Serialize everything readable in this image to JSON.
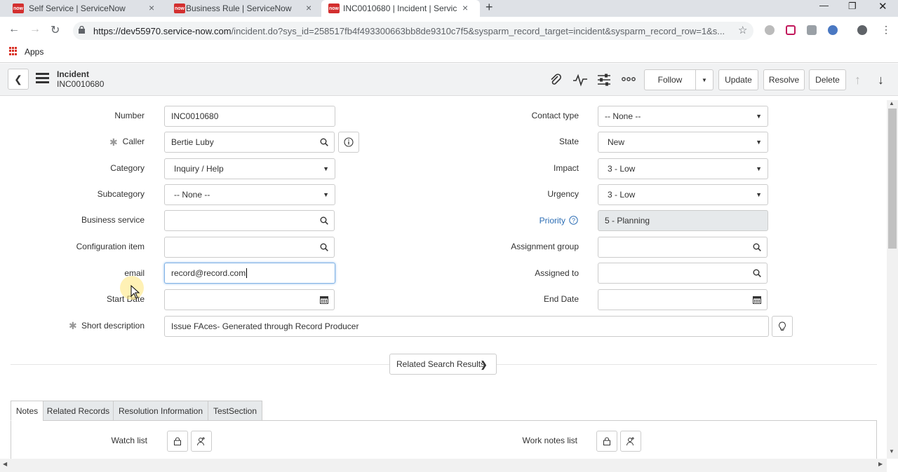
{
  "browser": {
    "tabs": [
      {
        "title": "Self Service | ServiceNow",
        "favicon": "now"
      },
      {
        "title": "Business Rule | ServiceNow",
        "favicon": "now"
      },
      {
        "title": "INC0010680 | Incident | ServiceN",
        "favicon": "now"
      }
    ],
    "url_main": "https://dev55970.service-now.com",
    "url_rest": "/incident.do?sys_id=258517fb4f493300663bb8de9310c7f5&sysparm_record_target=incident&sysparm_record_row=1&s...",
    "bookmarks_apps_label": "Apps"
  },
  "header": {
    "record_type": "Incident",
    "record_number": "INC0010680",
    "follow_label": "Follow",
    "update_label": "Update",
    "resolve_label": "Resolve",
    "delete_label": "Delete"
  },
  "form": {
    "left": {
      "number": {
        "label": "Number",
        "value": "INC0010680"
      },
      "caller": {
        "label": "Caller",
        "value": "Bertie Luby"
      },
      "category": {
        "label": "Category",
        "value": "Inquiry / Help"
      },
      "subcategory": {
        "label": "Subcategory",
        "value": "-- None --"
      },
      "business_service": {
        "label": "Business service",
        "value": ""
      },
      "configuration_item": {
        "label": "Configuration item",
        "value": ""
      },
      "email": {
        "label": "email",
        "value": "record@record.com"
      },
      "start_date": {
        "label": "Start Date",
        "value": ""
      }
    },
    "right": {
      "contact_type": {
        "label": "Contact type",
        "value": "-- None --"
      },
      "state": {
        "label": "State",
        "value": "New"
      },
      "impact": {
        "label": "Impact",
        "value": "3 - Low"
      },
      "urgency": {
        "label": "Urgency",
        "value": "3 - Low"
      },
      "priority": {
        "label": "Priority",
        "value": "5 - Planning"
      },
      "assignment_group": {
        "label": "Assignment group",
        "value": ""
      },
      "assigned_to": {
        "label": "Assigned to",
        "value": ""
      },
      "end_date": {
        "label": "End Date",
        "value": ""
      }
    },
    "short_description": {
      "label": "Short description",
      "value": "Issue FAces- Generated through Record Producer"
    },
    "related_search_label": "Related Search Results"
  },
  "section_tabs": [
    "Notes",
    "Related Records",
    "Resolution Information",
    "TestSection"
  ],
  "notes": {
    "watch_list_label": "Watch list",
    "work_notes_list_label": "Work notes list"
  },
  "colors": {
    "brand_red": "#d32f2f",
    "link_blue": "#2c6db4",
    "focus_blue": "#82b3e6"
  }
}
